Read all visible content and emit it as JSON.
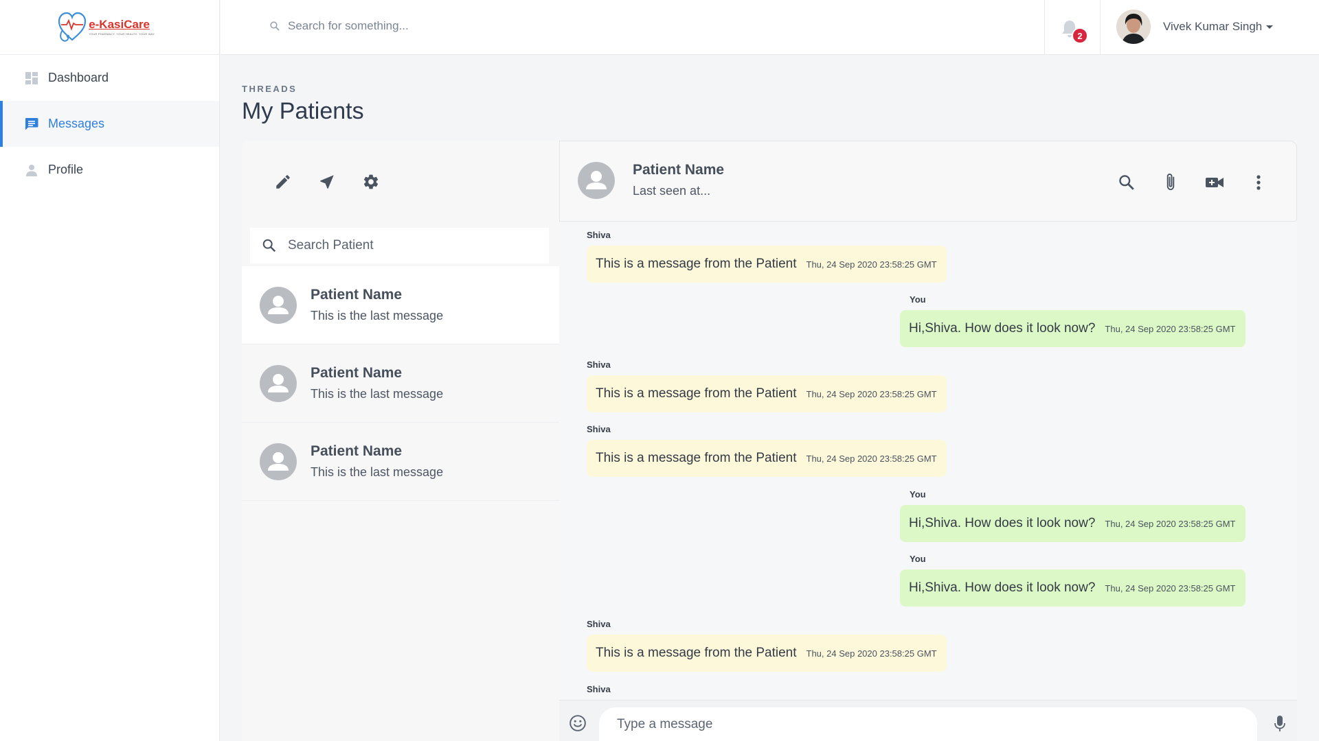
{
  "app": {
    "logo_text": "e-KasiCare",
    "logo_tagline": "YOUR PHARMACY. YOUR HEALTH. YOUR WAY.",
    "accent_color": "#2f7fdc"
  },
  "sidebar": {
    "items": [
      {
        "label": "Dashboard",
        "icon": "dashboard-icon",
        "active": false
      },
      {
        "label": "Messages",
        "icon": "chat-icon",
        "active": true
      },
      {
        "label": "Profile",
        "icon": "person-icon",
        "active": false
      }
    ]
  },
  "topbar": {
    "search_placeholder": "Search for something...",
    "notification_count": "2",
    "user_name": "Vivek Kumar Singh"
  },
  "page": {
    "eyebrow": "THREADS",
    "title": "My Patients"
  },
  "threads": {
    "search_placeholder": "Search Patient",
    "items": [
      {
        "name": "Patient Name",
        "last_message": "This is the last message"
      },
      {
        "name": "Patient Name",
        "last_message": "This is the last message"
      },
      {
        "name": "Patient Name",
        "last_message": "This is the last message"
      }
    ]
  },
  "chat": {
    "contact_name": "Patient Name",
    "status": "Last seen at...",
    "composer_placeholder": "Type a message",
    "messages": [
      {
        "sender": "Shiva",
        "text": "This is a message from the Patient",
        "time": "Thu, 24 Sep 2020 23:58:25 GMT",
        "direction": "in"
      },
      {
        "sender": "You",
        "text": "Hi,Shiva. How does it look now?",
        "time": "Thu, 24 Sep 2020 23:58:25 GMT",
        "direction": "out"
      },
      {
        "sender": "Shiva",
        "text": "This is a message from the Patient",
        "time": "Thu, 24 Sep 2020 23:58:25 GMT",
        "direction": "in"
      },
      {
        "sender": "Shiva",
        "text": "This is a message from the Patient",
        "time": "Thu, 24 Sep 2020 23:58:25 GMT",
        "direction": "in"
      },
      {
        "sender": "You",
        "text": "Hi,Shiva. How does it look now?",
        "time": "Thu, 24 Sep 2020 23:58:25 GMT",
        "direction": "out"
      },
      {
        "sender": "You",
        "text": "Hi,Shiva. How does it look now?",
        "time": "Thu, 24 Sep 2020 23:58:25 GMT",
        "direction": "out"
      },
      {
        "sender": "Shiva",
        "text": "This is a message from the Patient",
        "time": "Thu, 24 Sep 2020 23:58:25 GMT",
        "direction": "in"
      },
      {
        "sender": "Shiva",
        "text": "",
        "time": "",
        "direction": "in"
      }
    ]
  }
}
